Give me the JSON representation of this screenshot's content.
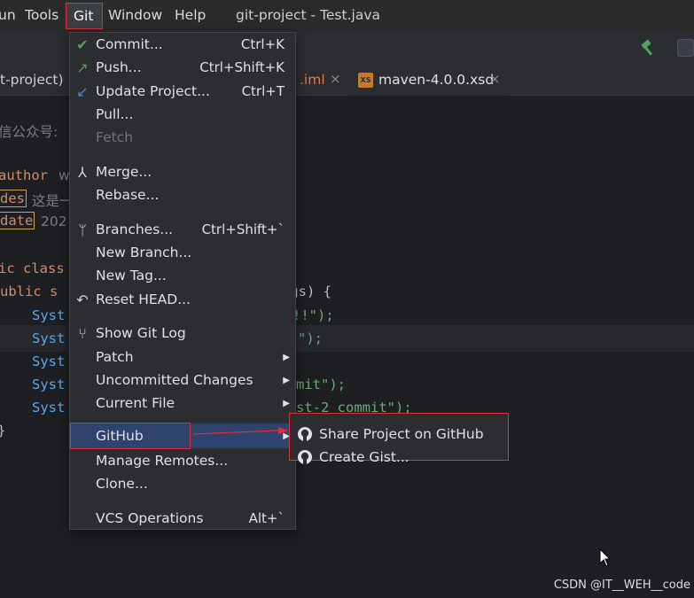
{
  "menubar": {
    "partial_item": "un",
    "tools": "Tools",
    "git": "Git",
    "window": "Window",
    "help": "Help",
    "title": "git-project - Test.java"
  },
  "tabs": {
    "project_label": "t-project)",
    "iml_label": ".iml",
    "xsd_label": "maven-4.0.0.xsd",
    "xsd_icon_text": "XS",
    "close": "×"
  },
  "editor": {
    "line1": "信公众号:",
    "line2a": "author",
    "line2b": "w",
    "line3a": "des",
    "line3b": "这是一",
    "line4a": "date",
    "line4b": "202",
    "line5": "ic class",
    "line6a": "ublic s",
    "line6b": "rgs) {",
    "line7a": "Syst",
    "line7b": "!!\");",
    "line8a": "Syst",
    "line8b": "\");",
    "line9a": "Syst",
    "line10a": "Syst",
    "line10b": "mit\");",
    "line11a": "Syst",
    "line11b": "st-2 commit\");",
    "line12": "}"
  },
  "git_menu": {
    "items": [
      {
        "label": "Commit...",
        "shortcut": "Ctrl+K",
        "icon": "check-icon"
      },
      {
        "label": "Push...",
        "shortcut": "Ctrl+Shift+K",
        "icon": "push-arrow-icon"
      },
      {
        "label": "Update Project...",
        "shortcut": "Ctrl+T",
        "icon": "update-arrow-icon"
      },
      {
        "label": "Pull...",
        "shortcut": ""
      },
      {
        "label": "Fetch",
        "shortcut": "",
        "disabled": true
      },
      {
        "label": "Merge...",
        "shortcut": "",
        "icon": "merge-icon"
      },
      {
        "label": "Rebase...",
        "shortcut": ""
      },
      {
        "label": "Branches...",
        "shortcut": "Ctrl+Shift+`",
        "icon": "branch-icon"
      },
      {
        "label": "New Branch...",
        "shortcut": ""
      },
      {
        "label": "New Tag...",
        "shortcut": ""
      },
      {
        "label": "Reset HEAD...",
        "shortcut": "",
        "icon": "undo-icon"
      },
      {
        "label": "Show Git Log",
        "shortcut": "",
        "icon": "git-log-icon"
      },
      {
        "label": "Patch",
        "shortcut": "",
        "submenu": true
      },
      {
        "label": "Uncommitted Changes",
        "shortcut": "",
        "submenu": true
      },
      {
        "label": "Current File",
        "shortcut": "",
        "submenu": true
      },
      {
        "label": "GitHub",
        "shortcut": "",
        "submenu": true,
        "selected": true
      },
      {
        "label": "Manage Remotes...",
        "shortcut": ""
      },
      {
        "label": "Clone...",
        "shortcut": ""
      },
      {
        "label": "VCS Operations",
        "shortcut": "Alt+`"
      }
    ]
  },
  "github_submenu": {
    "share": "Share Project on GitHub",
    "gist": "Create Gist..."
  },
  "watermark": "CSDN @IT__WEH__code",
  "colors": {
    "accent_select": "#2e436e",
    "annotation_red": "#e0303a",
    "menu_bg": "#2b2d30",
    "editor_bg": "#1e1f22"
  }
}
